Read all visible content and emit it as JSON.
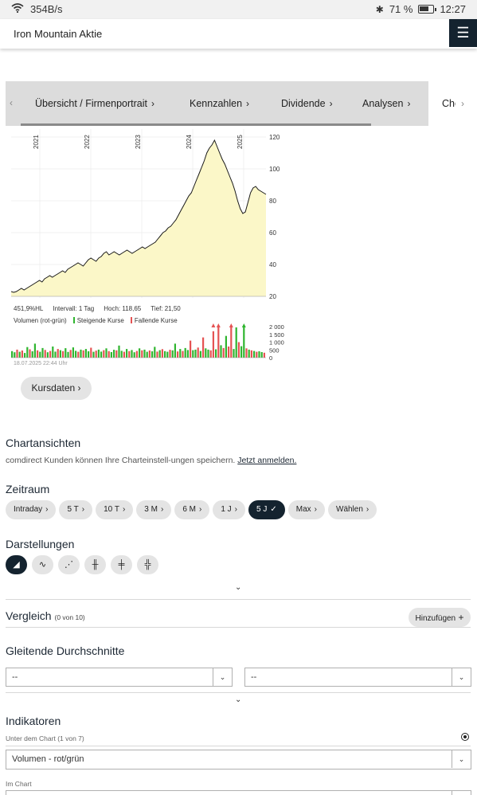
{
  "status_bar": {
    "network_speed": "354B/s",
    "battery": "71 %",
    "battery_level": 0.71,
    "time": "12:27"
  },
  "header": {
    "title": "Iron Mountain Aktie"
  },
  "tabs": [
    {
      "label": "Übersicht / Firmenportrait"
    },
    {
      "label": "Kennzahlen"
    },
    {
      "label": "Dividende"
    },
    {
      "label": "Analysen"
    },
    {
      "label": "Che"
    }
  ],
  "chart_data": {
    "type": "area",
    "x_labels": [
      "2021",
      "2022",
      "2023",
      "2024",
      "2025"
    ],
    "y_ticks": [
      "120",
      "100",
      "80",
      "60",
      "40",
      "20"
    ],
    "ylim": [
      20,
      120
    ],
    "series": [
      {
        "values": [
          23,
          22.5,
          23,
          24,
          25,
          24,
          25,
          26,
          27,
          28,
          29,
          30,
          29,
          31,
          32,
          33,
          32,
          33,
          34,
          35,
          36,
          35,
          37,
          38,
          39,
          40,
          41,
          40,
          39,
          41,
          43,
          44,
          43,
          42,
          44,
          45,
          47,
          48,
          46,
          47,
          48,
          47,
          46,
          47,
          48,
          49,
          48,
          47,
          48,
          49,
          50,
          51,
          50,
          51,
          52,
          53,
          54,
          56,
          58,
          60,
          61,
          63,
          64,
          66,
          68,
          71,
          74,
          77,
          80,
          83,
          85,
          89,
          93,
          97,
          101,
          105,
          110,
          113,
          115,
          118,
          114,
          110,
          106,
          103,
          99,
          95,
          91,
          86,
          80,
          75,
          72,
          73,
          79,
          85,
          88,
          89,
          87,
          86,
          85,
          84
        ]
      }
    ],
    "info": {
      "change": "451,9%HL",
      "interval": "Intervall: 1 Tag",
      "high": "Hoch: 118,65",
      "low": "Tief: 21,50"
    },
    "volume": {
      "label": "Volumen (rot-grün)",
      "legend_rising": "Steigende Kurse",
      "legend_falling": "Fallende Kurse",
      "y_ticks": [
        "2 000",
        "1 500",
        "1 000",
        "500",
        "0"
      ],
      "ylim": [
        0,
        2000
      ],
      "values": [
        420,
        350,
        520,
        380,
        460,
        300,
        680,
        540,
        410,
        900,
        470,
        380,
        620,
        500,
        350,
        430,
        720,
        390,
        560,
        480,
        420,
        610,
        370,
        500,
        660,
        440,
        380,
        520,
        470,
        560,
        410,
        640,
        380,
        450,
        520,
        390,
        480,
        600,
        420,
        360,
        510,
        470,
        780,
        440,
        380,
        560,
        420,
        490,
        350,
        430,
        600,
        470,
        520,
        380,
        460,
        410,
        700,
        390,
        480,
        550,
        420,
        380,
        510,
        470,
        900,
        400,
        560,
        430,
        620,
        490,
        1100,
        480,
        520,
        650,
        430,
        1300,
        600,
        520,
        470,
        1700,
        540,
        1950,
        800,
        620,
        1400,
        720,
        1950,
        560,
        1950,
        1000,
        740,
        1950,
        600,
        520,
        470,
        430,
        380,
        410,
        360,
        320
      ],
      "rising": [
        true,
        true,
        false,
        true,
        false,
        true,
        true,
        false,
        true,
        true,
        false,
        true,
        true,
        false,
        true,
        false,
        true,
        true,
        false,
        true,
        false,
        true,
        true,
        false,
        true,
        true,
        false,
        true,
        false,
        true,
        true,
        false,
        true,
        false,
        true,
        true,
        false,
        true,
        false,
        true,
        true,
        false,
        true,
        true,
        false,
        true,
        false,
        true,
        true,
        false,
        true,
        false,
        true,
        true,
        false,
        true,
        true,
        false,
        true,
        false,
        true,
        true,
        false,
        true,
        true,
        false,
        true,
        false,
        true,
        true,
        false,
        true,
        true,
        false,
        true,
        false,
        true,
        true,
        false,
        false,
        true,
        false,
        true,
        false,
        true,
        false,
        false,
        true,
        true,
        false,
        true,
        true,
        false,
        true,
        false,
        true,
        false,
        true,
        true,
        false
      ],
      "arrows_red_at": [
        79,
        81,
        86
      ],
      "arrows_green_at": [
        91
      ]
    },
    "colors": {
      "line": "#1a1a1a",
      "fill": "#fbf7c8",
      "rising": "#2fb52f",
      "falling": "#e55353",
      "grid": "#e6e6e6"
    }
  },
  "chart_timestamp": "18.07.2025 22:44 Uhr",
  "kursdaten_label": "Kursdaten",
  "chartansichten": {
    "heading": "Chartansichten",
    "text": "comdirect Kunden können Ihre Charteinstell-ungen speichern.",
    "link": "Jetzt anmelden."
  },
  "zeitraum": {
    "heading": "Zeitraum",
    "options": [
      {
        "label": "Intraday",
        "icon": "chevron-right-icon",
        "active": false
      },
      {
        "label": "5 T",
        "icon": "chevron-right-icon",
        "active": false
      },
      {
        "label": "10 T",
        "icon": "chevron-right-icon",
        "active": false
      },
      {
        "label": "3 M",
        "icon": "chevron-right-icon",
        "active": false
      },
      {
        "label": "6 M",
        "icon": "chevron-right-icon",
        "active": false
      },
      {
        "label": "1 J",
        "icon": "chevron-right-icon",
        "active": false
      },
      {
        "label": "5 J",
        "icon": "check-icon",
        "active": true
      },
      {
        "label": "Max",
        "icon": "chevron-right-icon",
        "active": false
      },
      {
        "label": "Wählen",
        "icon": "chevron-right-icon",
        "active": false
      }
    ]
  },
  "darstellungen": {
    "heading": "Darstellungen",
    "icons": [
      {
        "name": "area-chart-icon",
        "glyph": "◢",
        "active": true
      },
      {
        "name": "line-chart-icon",
        "glyph": "∿",
        "active": false
      },
      {
        "name": "point-line-chart-icon",
        "glyph": "⋰",
        "active": false
      },
      {
        "name": "ohlc-chart-icon",
        "glyph": "╫",
        "active": false
      },
      {
        "name": "bar-chart-icon",
        "glyph": "╪",
        "active": false
      },
      {
        "name": "candlestick-chart-icon",
        "glyph": "╬",
        "active": false
      }
    ]
  },
  "vergleich": {
    "heading": "Vergleich",
    "count": "(0 von 10)",
    "add_label": "Hinzufügen"
  },
  "gleitende": {
    "heading": "Gleitende Durchschnitte",
    "select1": "--",
    "select2": "--"
  },
  "indikatoren": {
    "heading": "Indikatoren",
    "under_label": "Unter dem Chart (1 von 7)",
    "select_value": "Volumen - rot/grün",
    "in_chart_label": "Im Chart"
  }
}
